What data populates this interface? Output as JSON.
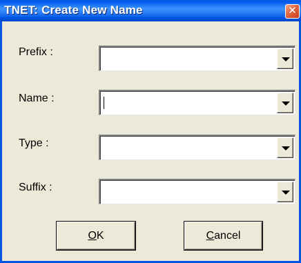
{
  "window": {
    "title": "TNET: Create New Name",
    "close_glyph": "✕"
  },
  "fields": [
    {
      "label": "Prefix :",
      "value": ""
    },
    {
      "label": "Name :",
      "value": ""
    },
    {
      "label": "Type :",
      "value": ""
    },
    {
      "label": "Suffix :",
      "value": ""
    }
  ],
  "buttons": {
    "ok": {
      "accel": "O",
      "rest": "K"
    },
    "cancel": {
      "accel": "C",
      "rest": "ancel"
    }
  },
  "colors": {
    "titlebar": "#0054E3",
    "close": "#E0663E",
    "dialog_bg": "#ECE9D8"
  },
  "icons": {
    "close": "close-icon",
    "dropdown": "chevron-down-icon"
  }
}
